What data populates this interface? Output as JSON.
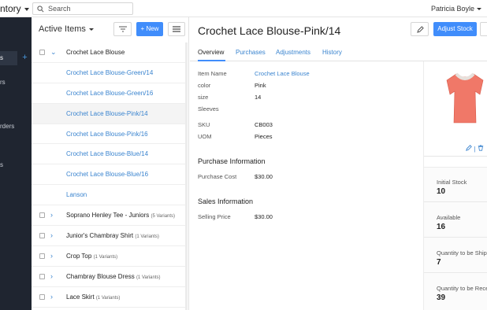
{
  "header": {
    "app_title": "ntory",
    "search_placeholder": "Search",
    "user_name": "Patricia Boyle"
  },
  "sidebar": {
    "items": [
      {
        "label": "s"
      },
      {
        "label": "rs"
      },
      {
        "label": "rders"
      },
      {
        "label": "s"
      }
    ]
  },
  "list": {
    "title": "Active Items",
    "new_label": "New",
    "rows": [
      {
        "label": "Crochet Lace Blouse",
        "variants": ""
      },
      {
        "label": "Crochet Lace Blouse-Green/14",
        "variants": ""
      },
      {
        "label": "Crochet Lace Blouse-Green/16",
        "variants": ""
      },
      {
        "label": "Crochet Lace Blouse-Pink/14",
        "variants": ""
      },
      {
        "label": "Crochet Lace Blouse-Pink/16",
        "variants": ""
      },
      {
        "label": "Crochet Lace Blouse-Blue/14",
        "variants": ""
      },
      {
        "label": "Crochet Lace Blouse-Blue/16",
        "variants": ""
      },
      {
        "label": "Lanson",
        "variants": ""
      },
      {
        "label": "Soprano Henley Tee - Juniors",
        "variants": "(5 Variants)"
      },
      {
        "label": "Junior's Chambray Shirt",
        "variants": "(1 Variants)"
      },
      {
        "label": "Crop Top",
        "variants": "(1 Variants)"
      },
      {
        "label": "Chambray Blouse Dress",
        "variants": "(1 Variants)"
      },
      {
        "label": "Lace Skirt",
        "variants": "(1 Variants)"
      }
    ]
  },
  "detail": {
    "title": "Crochet Lace Blouse-Pink/14",
    "adjust_label": "Adjust Stock",
    "tabs": [
      "Overview",
      "Purchases",
      "Adjustments",
      "History"
    ],
    "fields": [
      {
        "label": "Item Name",
        "value": "Crochet Lace Blouse"
      },
      {
        "label": "color",
        "value": "Pink"
      },
      {
        "label": "size",
        "value": "14"
      },
      {
        "label": "Sleeves",
        "value": ""
      },
      {
        "label": "SKU",
        "value": "CB003"
      },
      {
        "label": "UOM",
        "value": "Pieces"
      }
    ],
    "purchase": {
      "heading": "Purchase Information",
      "label": "Purchase Cost",
      "value": "$30.00"
    },
    "sales": {
      "heading": "Sales Information",
      "label": "Selling Price",
      "value": "$30.00"
    },
    "image_actions": "| ",
    "stock": [
      {
        "label": "Initial Stock",
        "value": "10"
      },
      {
        "label": "Available",
        "value": "16"
      },
      {
        "label": "Quantity to be Shipped",
        "value": "7"
      },
      {
        "label": "Quantity to be Received",
        "value": "39"
      }
    ]
  },
  "colors": {
    "accent": "#408dfb",
    "link": "#3a84cf",
    "sidebar_bg": "#1f2530",
    "product": "#f07868"
  }
}
